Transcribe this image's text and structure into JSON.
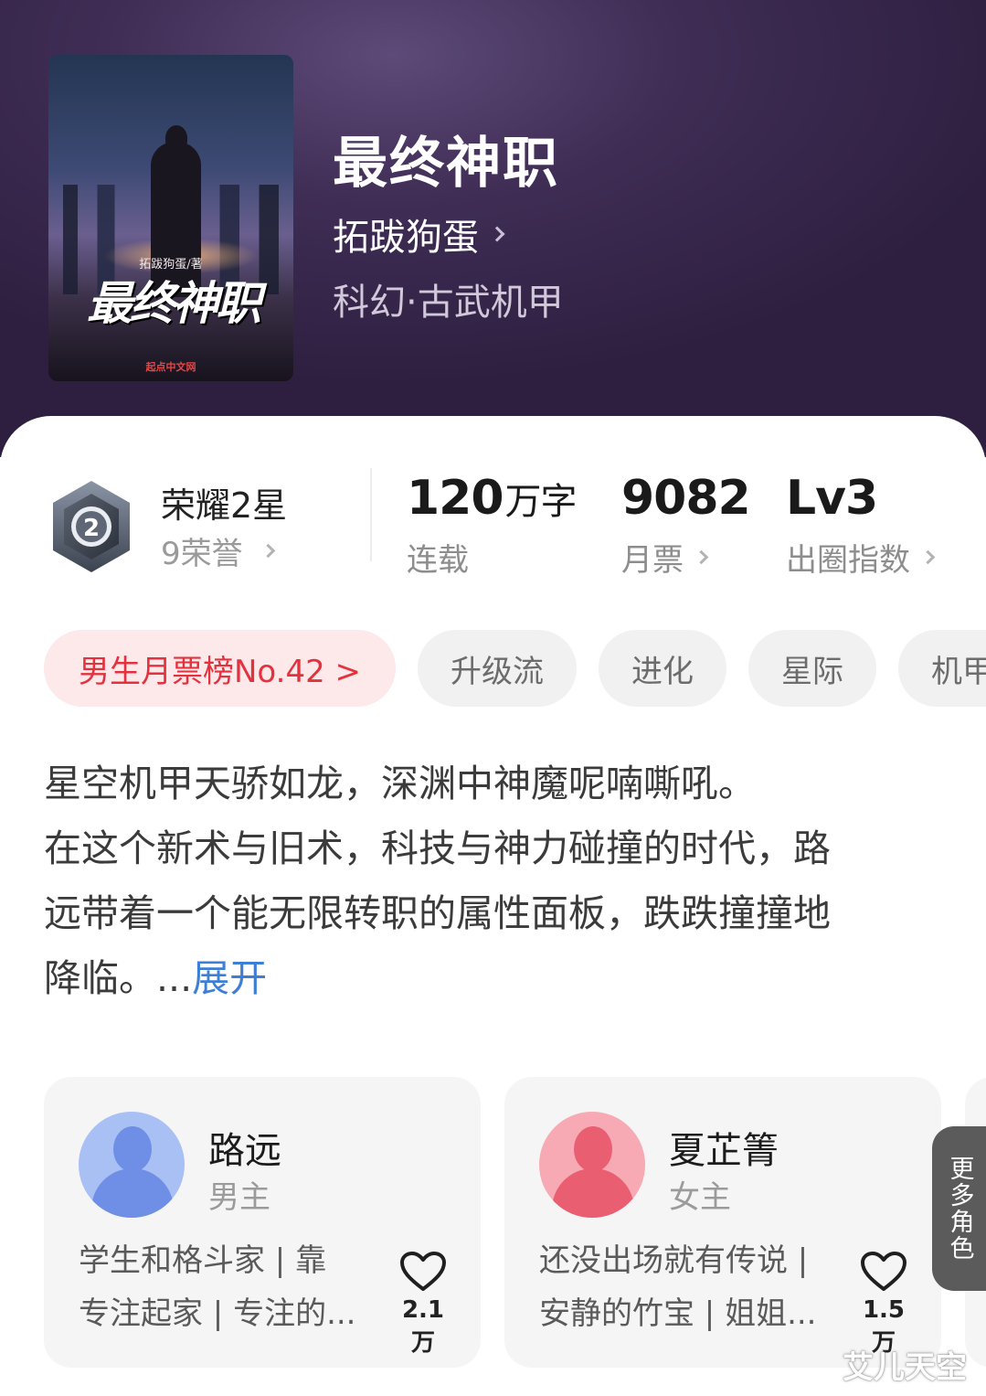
{
  "book": {
    "title": "最终神职",
    "author": "拓跋狗蛋",
    "genre": "科幻·古武机甲",
    "cover": {
      "author_line": "拓跋狗蛋/著",
      "title_art": "最终神职",
      "publisher": "起点中文网"
    }
  },
  "stats": {
    "honor": {
      "title": "荣耀2星",
      "sub": "9荣誉",
      "badge_number": "2"
    },
    "words": {
      "value": "120",
      "unit": "万字",
      "label": "连载"
    },
    "monthly_tickets": {
      "value": "9082",
      "label": "月票"
    },
    "breakout_index": {
      "value": "Lv3",
      "label": "出圈指数"
    }
  },
  "tags": {
    "rank": "男生月票榜No.42 >",
    "items": [
      "升级流",
      "进化",
      "星际",
      "机甲"
    ]
  },
  "synopsis": {
    "lines": [
      "星空机甲天骄如龙，深渊中神魔呢喃嘶吼。",
      "在这个新术与旧术，科技与神力碰撞的时代，路",
      "远带着一个能无限转职的属性面板，跌跌撞撞地",
      "降临。..."
    ],
    "expand_label": "展开"
  },
  "characters": [
    {
      "name": "路远",
      "role": "男主",
      "desc_line1": "学生和格斗家 | 靠",
      "desc_line2": "专注起家 | 专注的...",
      "likes": "2.1万",
      "avatar_color": "#7e9cec"
    },
    {
      "name": "夏芷箐",
      "role": "女主",
      "desc_line1": "还没出场就有传说 |",
      "desc_line2": "安静的竹宝 | 姐姐...",
      "likes": "1.5万",
      "avatar_color": "#ef7585"
    }
  ],
  "more_roles_label": "更多角色",
  "watermark": "艾儿天空"
}
